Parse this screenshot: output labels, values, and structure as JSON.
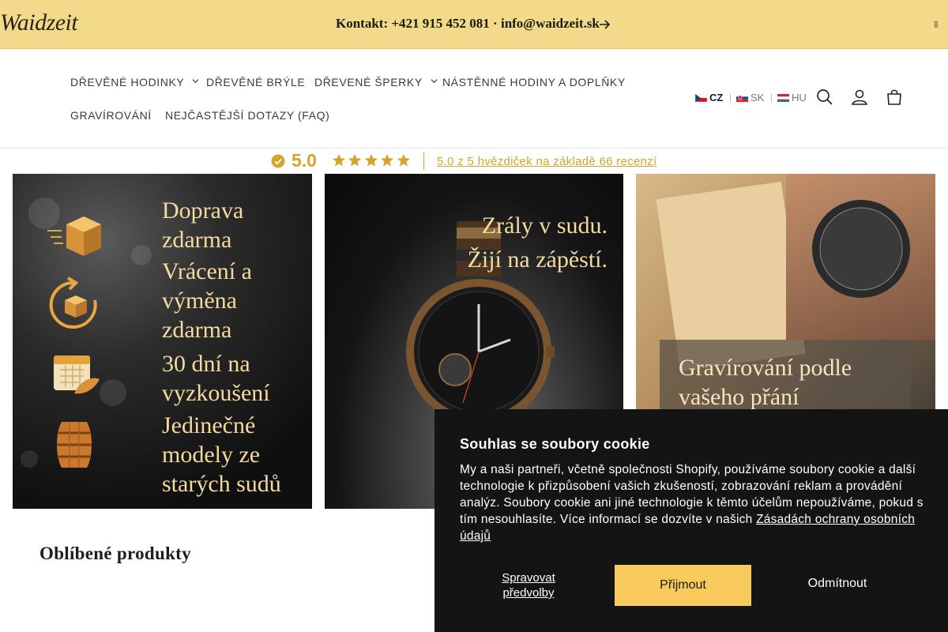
{
  "announcement": {
    "logo": "Waidzeit",
    "text": "Kontakt: +421 915 452 081 · info@waidzeit.sk",
    "arrow_icon": "arrow-right-icon",
    "pause_icon": "pause-icon"
  },
  "nav": {
    "items": [
      {
        "label": "DŘEVĚNÉ HODINKY",
        "has_dropdown": true
      },
      {
        "label": "DŘEVĚNÉ BRÝLE",
        "has_dropdown": false
      },
      {
        "label": "DŘEVENÉ ŠPERKY",
        "has_dropdown": true
      },
      {
        "label": "NÁSTĚNNÉ HODINY A DOPLŇKY",
        "has_dropdown": false
      },
      {
        "label": "GRAVÍROVÁNÍ",
        "has_dropdown": false
      },
      {
        "label": "NEJČASTĚJŠÍ DOTAZY (FAQ)",
        "has_dropdown": false
      }
    ]
  },
  "languages": [
    {
      "code": "CZ",
      "active": true
    },
    {
      "code": "SK",
      "active": false
    },
    {
      "code": "HU",
      "active": false
    }
  ],
  "header_icons": [
    "search-icon",
    "account-icon",
    "cart-icon"
  ],
  "rating": {
    "score": "5.0",
    "stars": 5,
    "summary": "5.0 z 5 hvězdiček na základě 66 recenzí"
  },
  "cards": {
    "features": [
      {
        "text": "Doprava zdarma",
        "icon": "delivery-box-icon"
      },
      {
        "text": "Vrácení a výměna zdarma",
        "icon": "return-box-icon"
      },
      {
        "text": "30 dní na vyzkoušení",
        "icon": "calendar-icon"
      },
      {
        "text": "Jedinečné modely ze starých sudů",
        "icon": "barrel-icon"
      }
    ],
    "watch_text": "Zrály v sudu.\nŽijí na zápěstí.",
    "engraving_text": "Gravírování podle\nvašeho přání"
  },
  "section_title": "Oblíbené produkty",
  "cookie": {
    "title": "Souhlas se soubory cookie",
    "text": "My a naši partneři, včetně společnosti Shopify, používáme soubory cookie a další technologie k přizpůsobení vašich zkušeností, zobrazování reklam a provádění analýz. Soubory cookie ani jiné technologie k těmto účelům nepoužíváme, pokud s tím nesouhlasíte. Více informací se dozvíte v našich ",
    "link": "Zásadách ochrany osobních údajů",
    "manage": "Spravovat předvolby",
    "accept": "Přijmout",
    "reject": "Odmítnout"
  },
  "colors": {
    "announcement_bg": "#f3d98a",
    "accent_gold": "#d4a52a",
    "cookie_bg": "#141414",
    "accept_button": "#f8c95b",
    "card_text": "#f3dba0"
  }
}
